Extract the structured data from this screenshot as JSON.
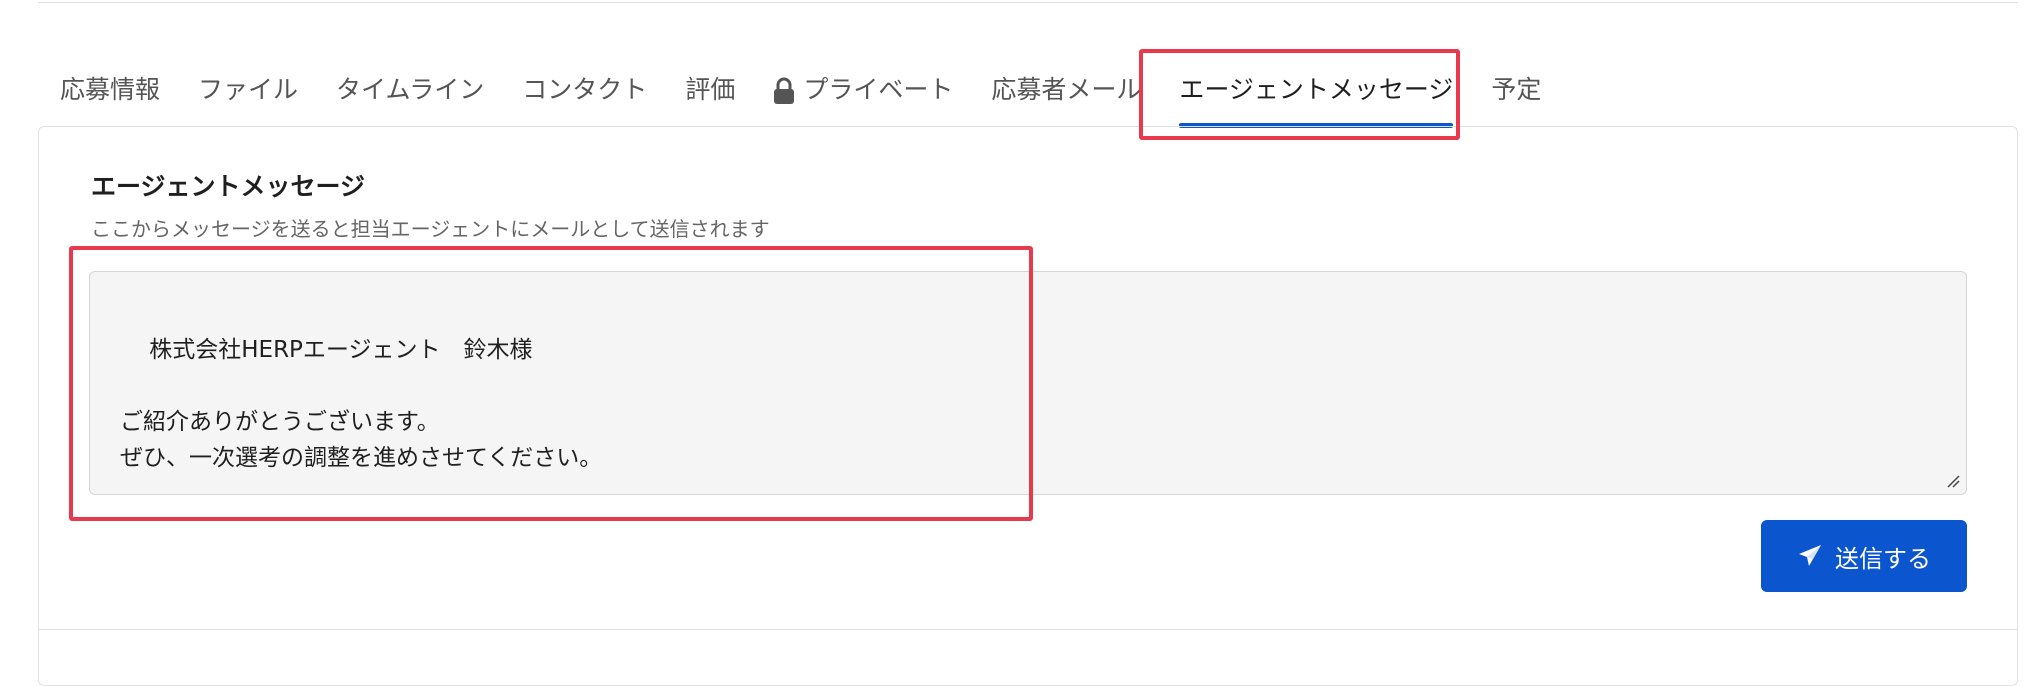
{
  "tabs": [
    {
      "label": "応募情報"
    },
    {
      "label": "ファイル"
    },
    {
      "label": "タイムライン"
    },
    {
      "label": "コンタクト"
    },
    {
      "label": "評価"
    },
    {
      "label": "プライベート",
      "icon": "lock-icon"
    },
    {
      "label": "応募者メール"
    },
    {
      "label": "エージェントメッセージ",
      "active": true
    },
    {
      "label": "予定"
    }
  ],
  "panel": {
    "title": "エージェントメッセージ",
    "description": "ここからメッセージを送ると担当エージェントにメールとして送信されます",
    "message": "株式会社HERPエージェント　鈴木様\n\nご紹介ありがとうございます。\nぜひ、一次選考の調整を進めさせてください。",
    "send_label": "送信する",
    "send_icon": "paper-plane-icon"
  },
  "colors": {
    "accent": "#0b55cf",
    "highlight": "#e8394d"
  }
}
